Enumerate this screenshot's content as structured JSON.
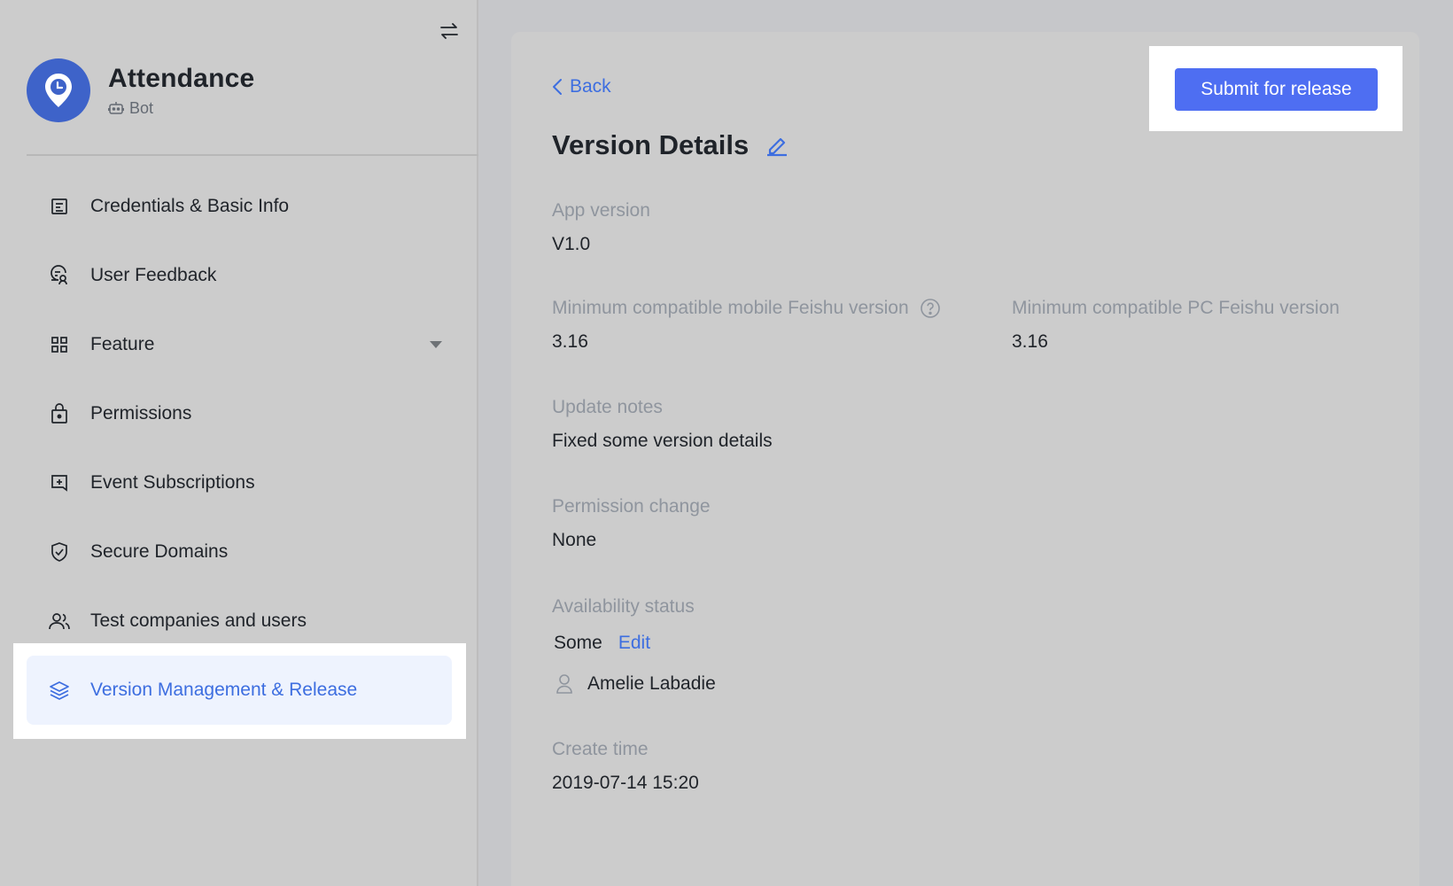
{
  "app": {
    "name": "Attendance",
    "type_label": "Bot",
    "avatar_color": "#3e63c9"
  },
  "sidebar": {
    "items": [
      {
        "label": "Credentials & Basic Info",
        "icon": "document-icon"
      },
      {
        "label": "User Feedback",
        "icon": "feedback-icon"
      },
      {
        "label": "Feature",
        "icon": "grid-icon"
      },
      {
        "label": "Permissions",
        "icon": "lock-icon"
      },
      {
        "label": "Event Subscriptions",
        "icon": "event-icon"
      },
      {
        "label": "Secure Domains",
        "icon": "shield-icon"
      },
      {
        "label": "Test companies and users",
        "icon": "users-icon"
      },
      {
        "label": "Version Management & Release",
        "icon": "layers-icon",
        "active": true
      }
    ]
  },
  "main": {
    "back_label": "Back",
    "title": "Version Details",
    "submit_label": "Submit for release",
    "fields": {
      "app_version": {
        "label": "App version",
        "value": "V1.0"
      },
      "min_mobile": {
        "label": "Minimum compatible mobile Feishu version",
        "value": "3.16"
      },
      "min_pc": {
        "label": "Minimum compatible PC Feishu version",
        "value": "3.16"
      },
      "update_notes": {
        "label": "Update notes",
        "value": "Fixed some version details"
      },
      "permission_change": {
        "label": "Permission change",
        "value": "None"
      },
      "availability": {
        "label": "Availability status",
        "value": "Some",
        "edit_label": "Edit",
        "user": "Amelie Labadie"
      },
      "create_time": {
        "label": "Create time",
        "value": "2019-07-14 15:20"
      }
    }
  },
  "colors": {
    "accent": "#3d6ee0",
    "button": "#4e6ef2",
    "muted_text": "#8f959e"
  }
}
